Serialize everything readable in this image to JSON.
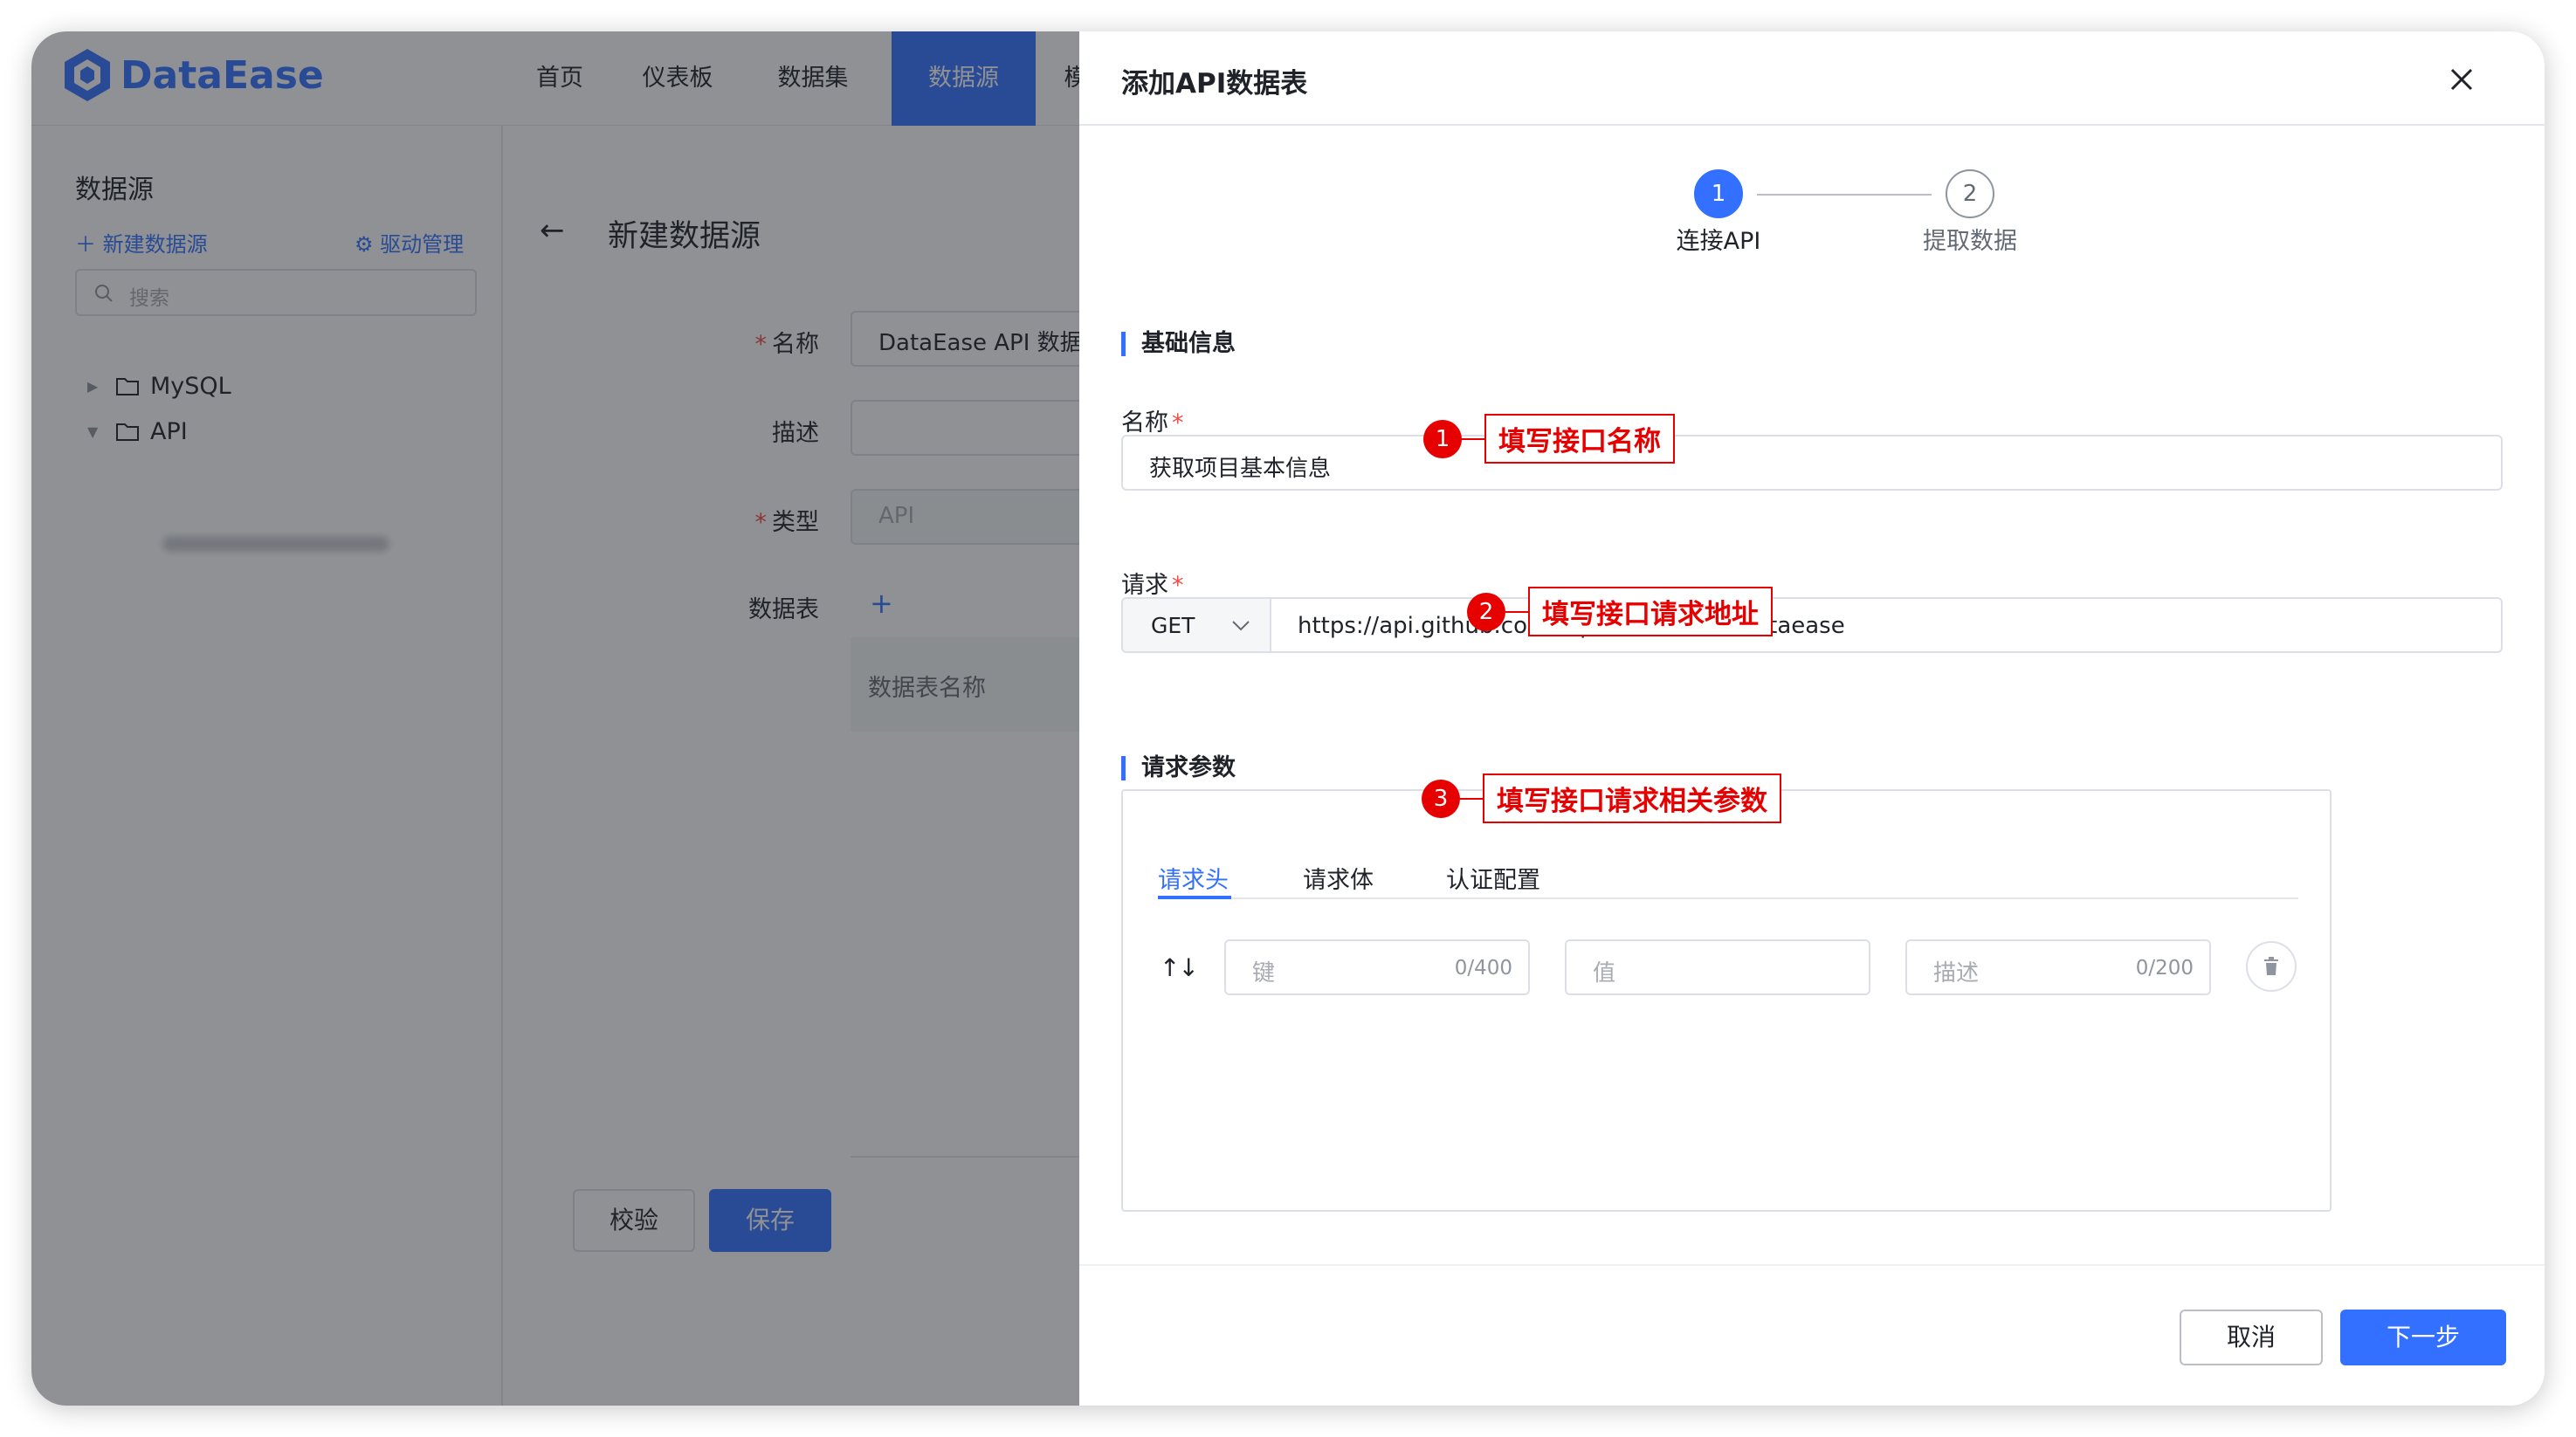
{
  "app": {
    "logo_text": "DataEase",
    "nav": [
      "首页",
      "仪表板",
      "数据集",
      "数据源",
      "模"
    ],
    "active_nav": "数据源",
    "brand_color": "#3370ff"
  },
  "sidebar": {
    "title": "数据源",
    "new_datasource": "新建数据源",
    "driver_manage": "驱动管理",
    "search_placeholder": "搜索",
    "tree": [
      {
        "label": "MySQL",
        "expanded": false
      },
      {
        "label": "API",
        "expanded": true
      }
    ]
  },
  "content": {
    "title": "新建数据源",
    "fields": {
      "name_label": "名称",
      "name_value": "DataEase API 数据源",
      "desc_label": "描述",
      "type_label": "类型",
      "type_value": "API",
      "table_label": "数据表"
    },
    "table_header": "数据表名称",
    "check_button": "校验",
    "save_button": "保存"
  },
  "drawer": {
    "title": "添加API数据表",
    "steps": [
      {
        "number": "1",
        "label": "连接API",
        "active": true
      },
      {
        "number": "2",
        "label": "提取数据",
        "active": false
      }
    ],
    "basic_info_title": "基础信息",
    "name_label": "名称",
    "name_value": "获取项目基本信息",
    "request_label": "请求",
    "method": "GET",
    "url": "https://api.github.com/repos/dataease/dataease",
    "params_title": "请求参数",
    "tabs": [
      "请求头",
      "请求体",
      "认证配置"
    ],
    "active_tab": "请求头",
    "header_row": {
      "key_placeholder": "键",
      "key_count": "0/400",
      "value_placeholder": "值",
      "desc_placeholder": "描述",
      "desc_count": "0/200"
    },
    "cancel_button": "取消",
    "next_button": "下一步"
  },
  "annotations": [
    {
      "number": "1",
      "text": "填写接口名称"
    },
    {
      "number": "2",
      "text": "填写接口请求地址"
    },
    {
      "number": "3",
      "text": "填写接口请求相关参数"
    }
  ],
  "annotation_color": "#e60000"
}
